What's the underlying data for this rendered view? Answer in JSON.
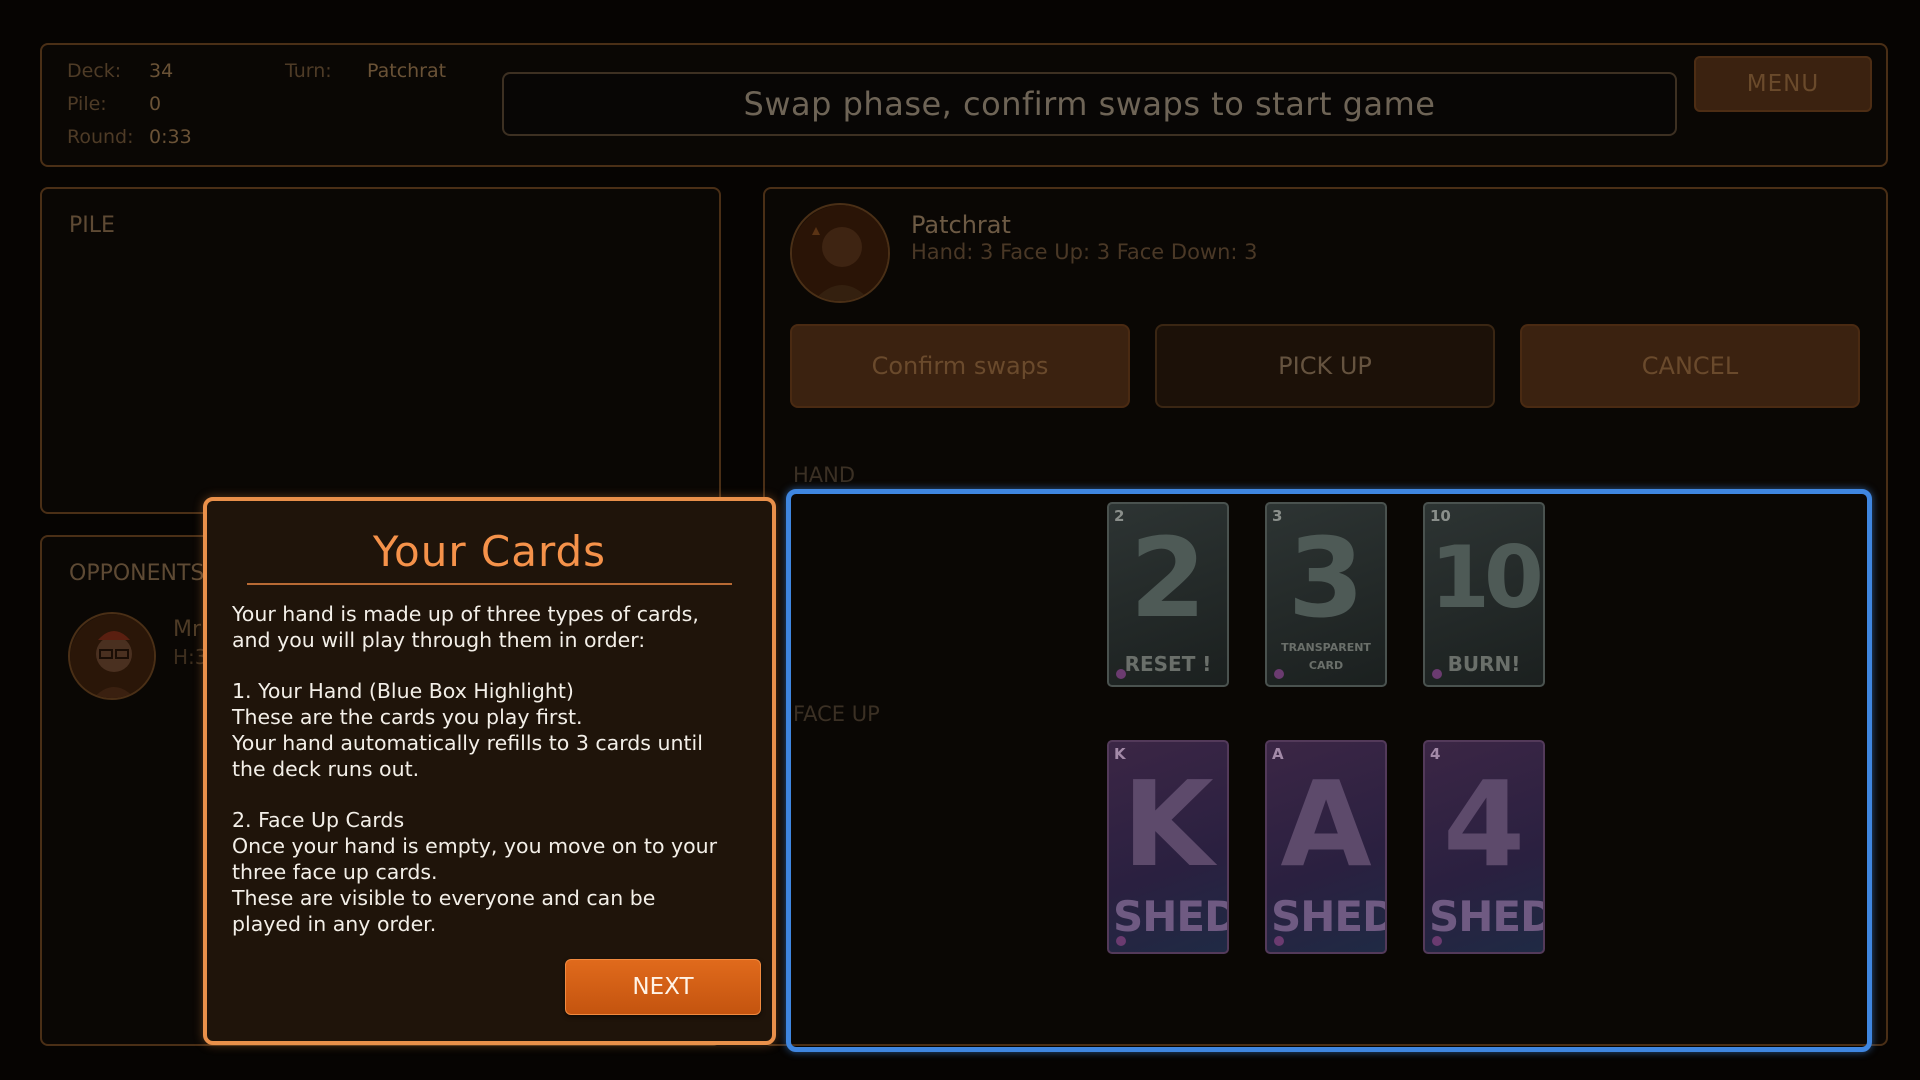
{
  "topbar": {
    "deck_label": "Deck:",
    "deck_value": "34",
    "pile_label": "Pile:",
    "pile_value": "0",
    "round_label": "Round:",
    "round_value": "0:33",
    "turn_label": "Turn:",
    "turn_value": "Patchrat",
    "status_message": "Swap phase, confirm swaps to start game",
    "menu_label": "MENU"
  },
  "pile_panel": {
    "title": "PILE"
  },
  "opponents_panel": {
    "title": "OPPONENTS",
    "opponent_name_partial": "Mr",
    "opponent_counts_partial": "H:3"
  },
  "player": {
    "name": "Patchrat",
    "counts": "Hand: 3  Face Up: 3  Face Down: 3",
    "confirm_label": "Confirm swaps",
    "pickup_label": "PICK UP",
    "cancel_label": "CANCEL",
    "hand_label": "HAND",
    "faceup_label": "FACE UP"
  },
  "hand_cards": [
    {
      "rank": "2",
      "caption": "RESET !"
    },
    {
      "rank": "3",
      "caption": "TRANSPARENT CARD"
    },
    {
      "rank": "10",
      "caption": "BURN!"
    }
  ],
  "faceup_cards": [
    {
      "rank": "K",
      "caption": "SHED"
    },
    {
      "rank": "A",
      "caption": "SHED"
    },
    {
      "rank": "4",
      "caption": "SHED"
    }
  ],
  "dialog": {
    "title": "Your Cards",
    "body": "Your hand is made up of three types of cards,\nand you will play through them in order:\n\n1. Your Hand (Blue Box Highlight)\nThese are the cards you play first.\nYour hand automatically refills to 3 cards until\nthe deck runs out.\n\n2. Face Up Cards\nOnce your hand is empty, you move on to your\nthree face up cards.\nThese are visible to everyone and can be\nplayed in any order.",
    "next_label": "NEXT"
  },
  "colors": {
    "accent_orange": "#e9904a",
    "next_button": "#d9621a",
    "hand_highlight": "#3f86e0",
    "background": "#060402"
  },
  "icons": [
    "player-avatar-icon",
    "opponent-avatar-icon"
  ]
}
